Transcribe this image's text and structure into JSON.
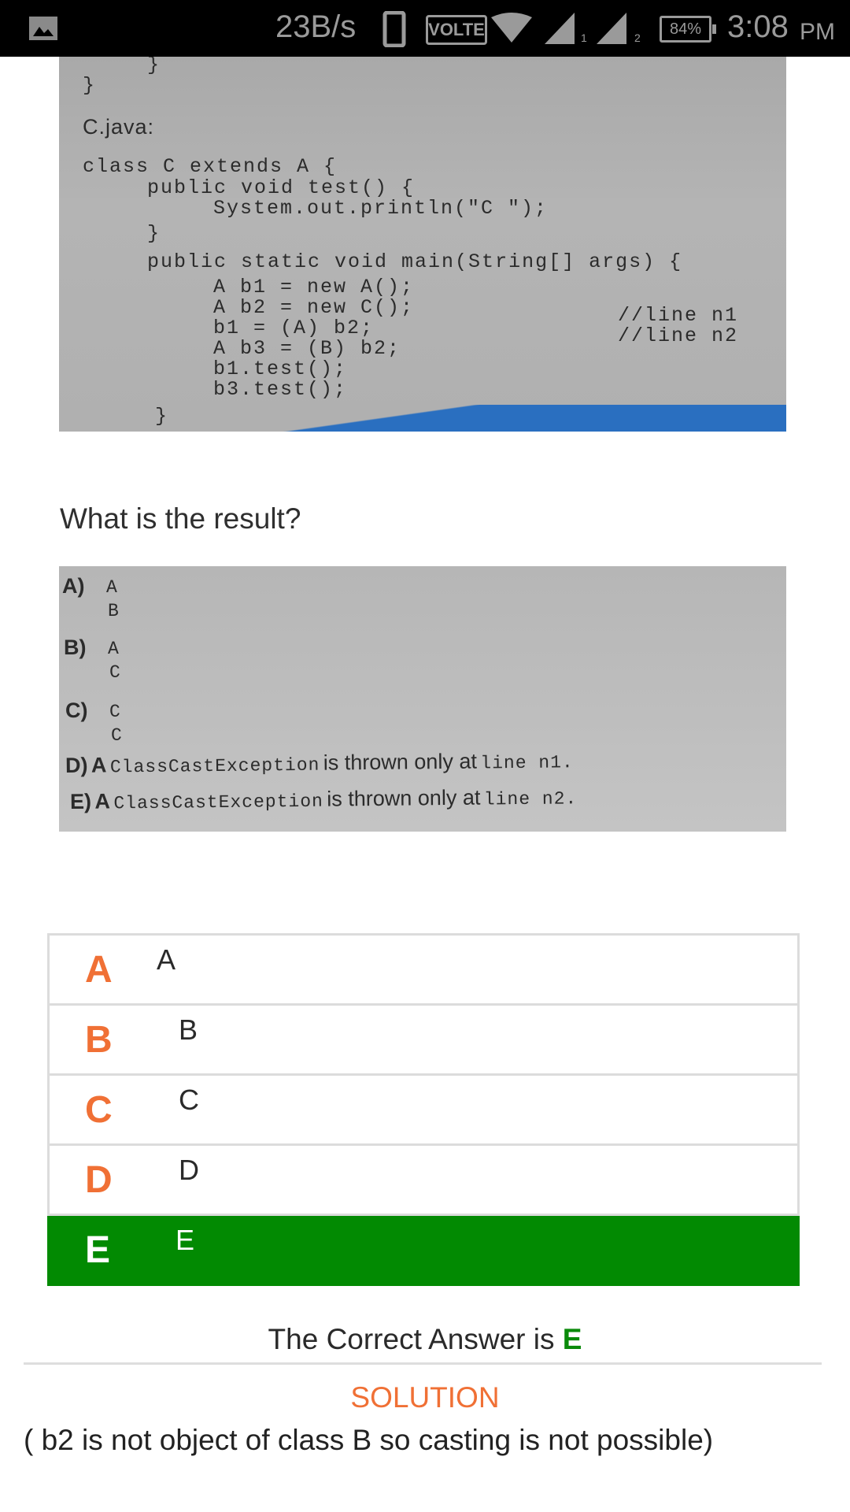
{
  "status_bar": {
    "net_speed": "23B/s",
    "volte": "VOLTE",
    "sim1": "1",
    "sim2": "2",
    "battery": "84%",
    "time": "3:08",
    "ampm": "PM"
  },
  "code_image": {
    "lines": [
      "}",
      "}",
      "C.java:",
      "class C extends A {",
      "public void test() {",
      "System.out.println(\"C \");",
      "}",
      "public static void main(String[] args) {",
      "A b1 = new A();",
      "A b2 = new C();",
      "b1 = (A) b2;",
      "//line n1",
      "A b3 = (B) b2;",
      "//line n2",
      "b1.test();",
      "b3.test();",
      "}"
    ]
  },
  "question": "What is the result?",
  "options_image": {
    "a_label": "A)",
    "a1": "A",
    "a2": "B",
    "b_label": "B)",
    "b1": "A",
    "b2": "C",
    "c_label": "C)",
    "c1": "C",
    "c2": "C",
    "d_label": "D)",
    "d_pre": "A",
    "d_code": "ClassCastException",
    "d_mid": "is thrown only at",
    "d_line": "line n1.",
    "e_label": "E)",
    "e_pre": "A",
    "e_code": "ClassCastException",
    "e_mid": "is thrown only at",
    "e_line": "line n2."
  },
  "answers": [
    {
      "letter": "A",
      "text": "A"
    },
    {
      "letter": "B",
      "text": "B"
    },
    {
      "letter": "C",
      "text": "C"
    },
    {
      "letter": "D",
      "text": "D"
    },
    {
      "letter": "E",
      "text": "E"
    }
  ],
  "result": {
    "prefix": "The Correct Answer is",
    "answer": "E"
  },
  "solution": {
    "title": "SOLUTION",
    "text": "( b2 is not object of class B so casting is not possible)"
  },
  "colors": {
    "accent": "#f07035",
    "correct": "#028a02"
  }
}
